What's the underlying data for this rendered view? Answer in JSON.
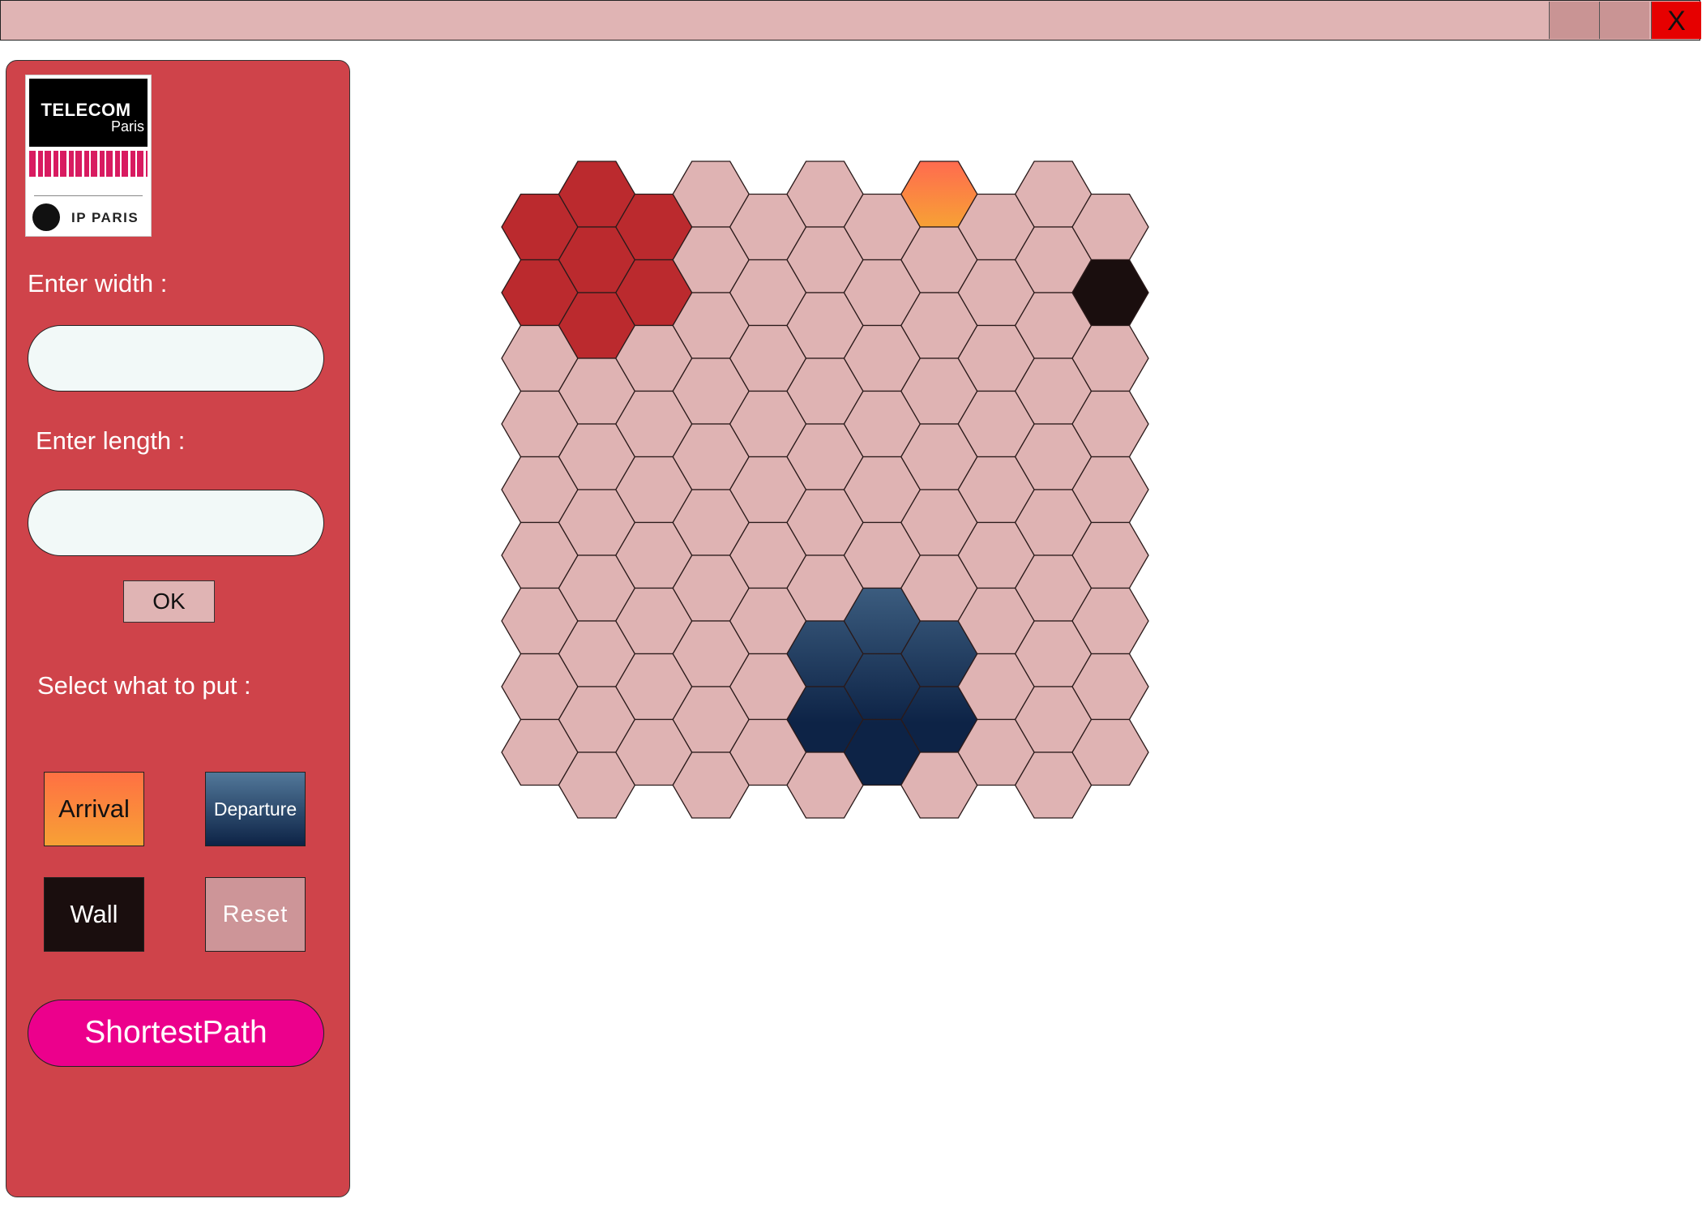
{
  "window": {
    "close_label": "X"
  },
  "sidebar": {
    "logo": {
      "telecom": "TELECOM",
      "paris": "Paris",
      "ip_paris": "IP PARIS"
    },
    "width_label": "Enter width :",
    "width_value": "",
    "length_label": "Enter length :",
    "length_value": "",
    "ok_label": "OK",
    "select_label": "Select what to put :",
    "tools": {
      "arrival": "Arrival",
      "departure": "Departure",
      "wall": "Wall",
      "reset": "Reset"
    },
    "shortest_path_label": "ShortestPath"
  },
  "grid": {
    "columns": 11,
    "rows": 9,
    "colors": {
      "empty": "#dfb3b3",
      "highlight": "#bb2a2e",
      "wall": "#1a0e0e",
      "arrival_top": "#ff6b4f",
      "arrival_bottom": "#f7a135",
      "departure_top": "#52789a",
      "departure_bottom": "#0d2346"
    },
    "special_cells": [
      {
        "col": 0,
        "row": 0,
        "state": "highlight"
      },
      {
        "col": 1,
        "row": 0,
        "state": "highlight"
      },
      {
        "col": 2,
        "row": 0,
        "state": "highlight"
      },
      {
        "col": 0,
        "row": 1,
        "state": "highlight"
      },
      {
        "col": 1,
        "row": 1,
        "state": "highlight"
      },
      {
        "col": 2,
        "row": 1,
        "state": "highlight"
      },
      {
        "col": 1,
        "row": 2,
        "state": "highlight"
      },
      {
        "col": 7,
        "row": 0,
        "state": "arrival"
      },
      {
        "col": 10,
        "row": 1,
        "state": "wall"
      },
      {
        "col": 6,
        "row": 6,
        "state": "departure"
      },
      {
        "col": 5,
        "row": 7,
        "state": "departure"
      },
      {
        "col": 6,
        "row": 7,
        "state": "departure"
      },
      {
        "col": 7,
        "row": 7,
        "state": "departure"
      },
      {
        "col": 5,
        "row": 8,
        "state": "departure"
      },
      {
        "col": 6,
        "row": 8,
        "state": "departure"
      },
      {
        "col": 7,
        "row": 8,
        "state": "departure"
      },
      {
        "col": 6,
        "row": 9,
        "state": "departure"
      }
    ]
  }
}
